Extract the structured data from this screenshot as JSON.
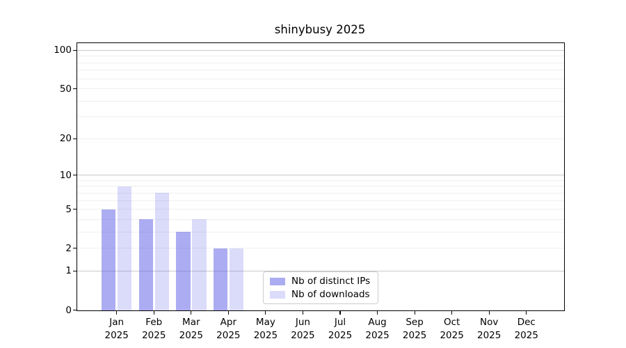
{
  "figure": {
    "background": "#ffffff",
    "text_color": "#000000",
    "spine_color": "#000000"
  },
  "chart_data": {
    "type": "bar",
    "title": "shinybusy 2025",
    "categories": [
      "Jan",
      "Feb",
      "Mar",
      "Apr",
      "May",
      "Jun",
      "Jul",
      "Aug",
      "Sep",
      "Oct",
      "Nov",
      "Dec"
    ],
    "x_tick_year": "2025",
    "series": [
      {
        "name": "Nb of distinct IPs",
        "color": "rgba(90,90,230,0.5)",
        "values": [
          5,
          4,
          3,
          2,
          0,
          0,
          0,
          0,
          0,
          0,
          0,
          0
        ]
      },
      {
        "name": "Nb of downloads",
        "color": "rgba(90,90,230,0.22)",
        "values": [
          8,
          7,
          4,
          2,
          0,
          0,
          0,
          0,
          0,
          0,
          0,
          0
        ]
      }
    ],
    "y_axis": {
      "scale": "log1p",
      "ticks": [
        0,
        1,
        2,
        5,
        10,
        20,
        50,
        100
      ],
      "range": [
        0,
        114
      ]
    },
    "x_axis": {
      "tick_count": 12
    },
    "grid": {
      "minor_values": [
        2,
        3,
        4,
        5,
        6,
        7,
        8,
        9,
        20,
        30,
        40,
        50,
        60,
        70,
        80,
        90
      ],
      "major_values": [
        1,
        10,
        100
      ],
      "minor_color": "#efefef",
      "major_color": "#c9c9c9"
    },
    "legend": {
      "position": "lower center",
      "entries": [
        "Nb of distinct IPs",
        "Nb of downloads"
      ]
    }
  }
}
